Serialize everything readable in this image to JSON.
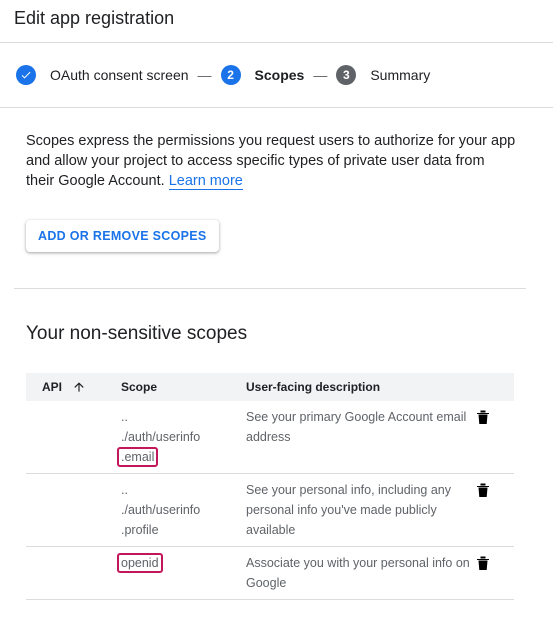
{
  "header": {
    "title": "Edit app registration"
  },
  "stepper": {
    "steps": [
      {
        "number": "✓",
        "label": "OAuth consent screen",
        "state": "done"
      },
      {
        "number": "2",
        "label": "Scopes",
        "state": "active"
      },
      {
        "number": "3",
        "label": "Summary",
        "state": "inactive"
      }
    ],
    "separator": "—"
  },
  "intro": {
    "text": "Scopes express the permissions you request users to authorize for your app and allow your project to access specific types of private user data from their Google Account.",
    "link": "Learn more"
  },
  "add_button": {
    "label": "ADD OR REMOVE SCOPES"
  },
  "section": {
    "title": "Your non-sensitive scopes"
  },
  "table": {
    "columns": {
      "api": "API",
      "scope": "Scope",
      "description": "User-facing description"
    },
    "rows": [
      {
        "scope_lines": [
          "..",
          "./auth/userinfo"
        ],
        "scope_highlight": ".email",
        "description": "See your primary Google Account email address"
      },
      {
        "scope_lines": [
          "..",
          "./auth/userinfo",
          ".profile"
        ],
        "scope_highlight": "",
        "description": "See your personal info, including any personal info you've made publicly available"
      },
      {
        "scope_lines": [],
        "scope_highlight": "openid",
        "description": "Associate you with your personal info on Google"
      }
    ]
  },
  "colors": {
    "accent": "#1a73e8",
    "highlight": "#c2185b",
    "inactive_step": "#5f6368"
  },
  "icons": {
    "done": "check-icon",
    "sort": "arrow-up-icon",
    "delete": "trash-icon"
  }
}
